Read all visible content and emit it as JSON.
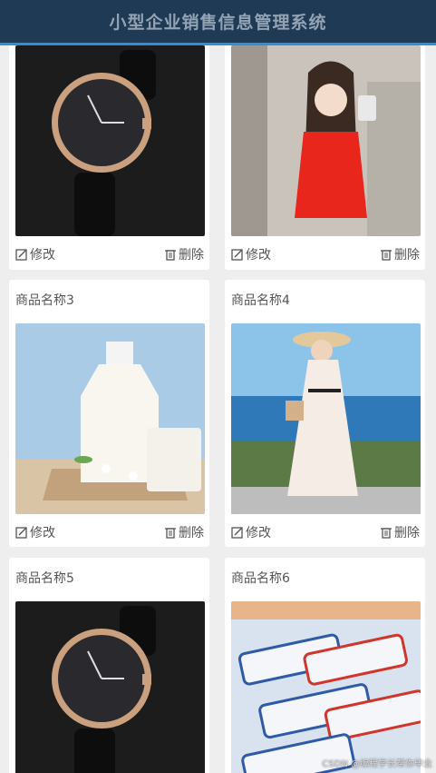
{
  "header": {
    "title": "小型企业销售信息管理系统"
  },
  "actions": {
    "edit_label": "修改",
    "delete_label": "删除"
  },
  "products": [
    {
      "name": "",
      "image_icon": "watch-image"
    },
    {
      "name": "",
      "image_icon": "red-top-woman-image"
    },
    {
      "name": "商品名称3",
      "image_icon": "milk-image"
    },
    {
      "name": "商品名称4",
      "image_icon": "beach-dress-woman-image"
    },
    {
      "name": "商品名称5",
      "image_icon": "watch-image"
    },
    {
      "name": "商品名称6",
      "image_icon": "candy-image"
    }
  ],
  "watermark": "CSDN @编程学长帮你毕业"
}
